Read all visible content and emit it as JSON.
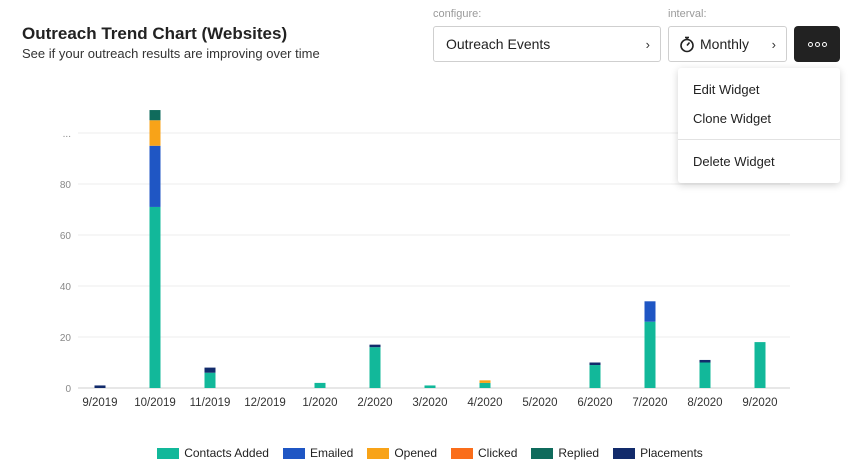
{
  "header": {
    "title": "Outreach Trend Chart (Websites)",
    "subtitle": "See if your outreach results are improving over time"
  },
  "controls": {
    "configure_caption": "configure:",
    "configure_value": "Outreach Events",
    "interval_caption": "interval:",
    "interval_value": "Monthly",
    "timer_icon": "stopwatch-icon",
    "menu_icon": "more-options-icon"
  },
  "menu": {
    "edit": "Edit Widget",
    "clone": "Clone Widget",
    "delete": "Delete Widget"
  },
  "chart_data": {
    "type": "bar",
    "stacked": true,
    "categories": [
      "9/2019",
      "10/2019",
      "11/2019",
      "12/2019",
      "1/2020",
      "2/2020",
      "3/2020",
      "4/2020",
      "5/2020",
      "6/2020",
      "7/2020",
      "8/2020",
      "9/2020"
    ],
    "y_ticks": [
      "0",
      "20",
      "40",
      "60",
      "80",
      "..."
    ],
    "ylim": [
      0,
      100
    ],
    "grid": true,
    "legend_position": "bottom",
    "series": [
      {
        "name": "Contacts Added",
        "color": "#12b89a",
        "values": [
          0,
          71,
          6,
          0,
          2,
          16,
          1,
          2,
          0,
          9,
          26,
          10,
          18
        ]
      },
      {
        "name": "Emailed",
        "color": "#1f56c4",
        "values": [
          0,
          24,
          0,
          0,
          0,
          0,
          0,
          0,
          0,
          0,
          8,
          0,
          0
        ]
      },
      {
        "name": "Opened",
        "color": "#f8a318",
        "values": [
          0,
          10,
          0,
          0,
          0,
          0,
          0,
          1,
          0,
          0,
          0,
          0,
          0
        ]
      },
      {
        "name": "Clicked",
        "color": "#fa6d1a",
        "values": [
          0,
          0,
          0,
          0,
          0,
          0,
          0,
          0,
          0,
          0,
          0,
          0,
          0
        ]
      },
      {
        "name": "Replied",
        "color": "#0f6b5c",
        "values": [
          0,
          4,
          0,
          0,
          0,
          0,
          0,
          0,
          0,
          0,
          0,
          0,
          0
        ]
      },
      {
        "name": "Placements",
        "color": "#122b6b",
        "values": [
          1,
          0,
          2,
          0,
          0,
          1,
          0,
          0,
          0,
          1,
          0,
          1,
          0
        ]
      }
    ]
  }
}
